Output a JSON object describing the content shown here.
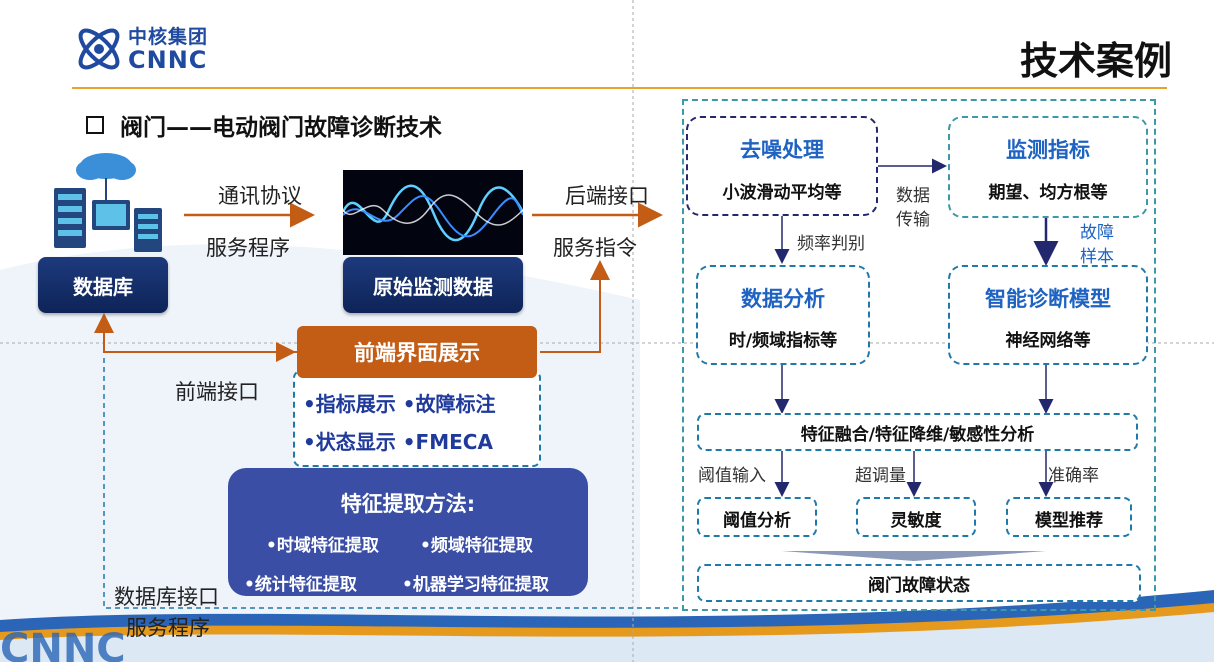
{
  "header": {
    "logo_cn": "中核集团",
    "logo_en": "CNNC",
    "title": "技术案例",
    "subtitle": "阀门——电动阀门故障诊断技术"
  },
  "left": {
    "database": "数据库",
    "raw_data": "原始监测数据",
    "comm_protocol": "通讯协议",
    "service_program": "服务程序",
    "backend_interface": "后端接口",
    "service_command": "服务指令",
    "frontend_interface": "前端接口",
    "frontend_display": "前端界面展示",
    "display_items": [
      "•指标展示",
      "•故障标注",
      "•状态显示",
      "•FMECA"
    ],
    "feature_title": "特征提取方法:",
    "feature_items": [
      "•时域特征提取",
      "•频域特征提取",
      "•统计特征提取",
      "•机器学习特征提取"
    ],
    "db_interface": "数据库接口",
    "db_service": "服务程序"
  },
  "right": {
    "denoise_title": "去噪处理",
    "denoise_sub": "小波滑动平均等",
    "monitor_title": "监测指标",
    "monitor_sub": "期望、均方根等",
    "data_transfer_1": "数据",
    "data_transfer_2": "传输",
    "freq_judge": "频率判别",
    "fault_sample_1": "故障",
    "fault_sample_2": "样本",
    "analysis_title": "数据分析",
    "analysis_sub": "时/频域指标等",
    "model_title": "智能诊断模型",
    "model_sub": "神经网络等",
    "fusion": "特征融合/特征降维/敏感性分析",
    "threshold_input": "阈值输入",
    "overshoot": "超调量",
    "accuracy": "准确率",
    "threshold_analysis": "阈值分析",
    "sensitivity": "灵敏度",
    "model_reasoning": "模型推荐",
    "valve_state": "阀门故障状态"
  },
  "colors": {
    "orange": "#c35d16",
    "navy": "#0e2458",
    "accent_blue": "#1f63c2",
    "feature_bg": "#3b4ea5"
  }
}
